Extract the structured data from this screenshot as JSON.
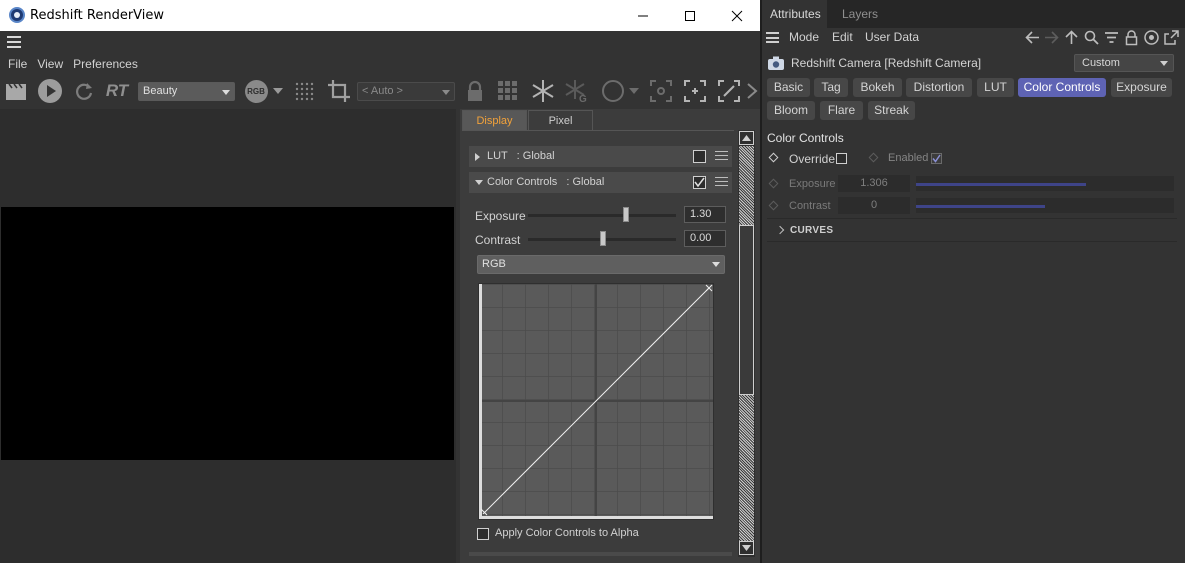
{
  "renderview": {
    "title": "Redshift RenderView",
    "menu": [
      "File",
      "View",
      "Preferences"
    ],
    "toolbar": {
      "aov_value": "Beauty",
      "rgb_badge": "RGB",
      "rt_label": "RT",
      "zoom_value": "< Auto >"
    },
    "display_panel": {
      "tabs": [
        "Display",
        "Pixel"
      ],
      "active_tab": "Display",
      "lut_section": {
        "label": "LUT",
        "scope": ": Global",
        "checked": false
      },
      "cc_section": {
        "label": "Color Controls",
        "scope": ": Global",
        "checked": true
      },
      "exposure": {
        "label": "Exposure",
        "value": "1.30"
      },
      "contrast": {
        "label": "Contrast",
        "value": "0.00"
      },
      "channel": "RGB",
      "alpha_checkbox": "Apply Color Controls to Alpha"
    }
  },
  "attributes": {
    "tabs": [
      "Attributes",
      "Layers"
    ],
    "menu": [
      "Mode",
      "Edit",
      "User Data"
    ],
    "object_name": "Redshift Camera [Redshift Camera]",
    "preset": "Custom",
    "chips_row1": [
      "Basic",
      "Tag",
      "Bokeh",
      "Distortion",
      "LUT",
      "Color Controls",
      "Exposure"
    ],
    "chips_row2": [
      "Bloom",
      "Flare",
      "Streak"
    ],
    "active_chip": "Color Controls",
    "section_title": "Color Controls",
    "override_label": "Override",
    "enabled_label": "Enabled",
    "exposure": {
      "label": "Exposure",
      "value": "1.306"
    },
    "contrast": {
      "label": "Contrast",
      "value": "0"
    },
    "curves_label": "CURVES"
  },
  "colors": {
    "accent": "#5e63b4",
    "orange_tab": "#f2a23a",
    "panel_bg": "#333333"
  }
}
